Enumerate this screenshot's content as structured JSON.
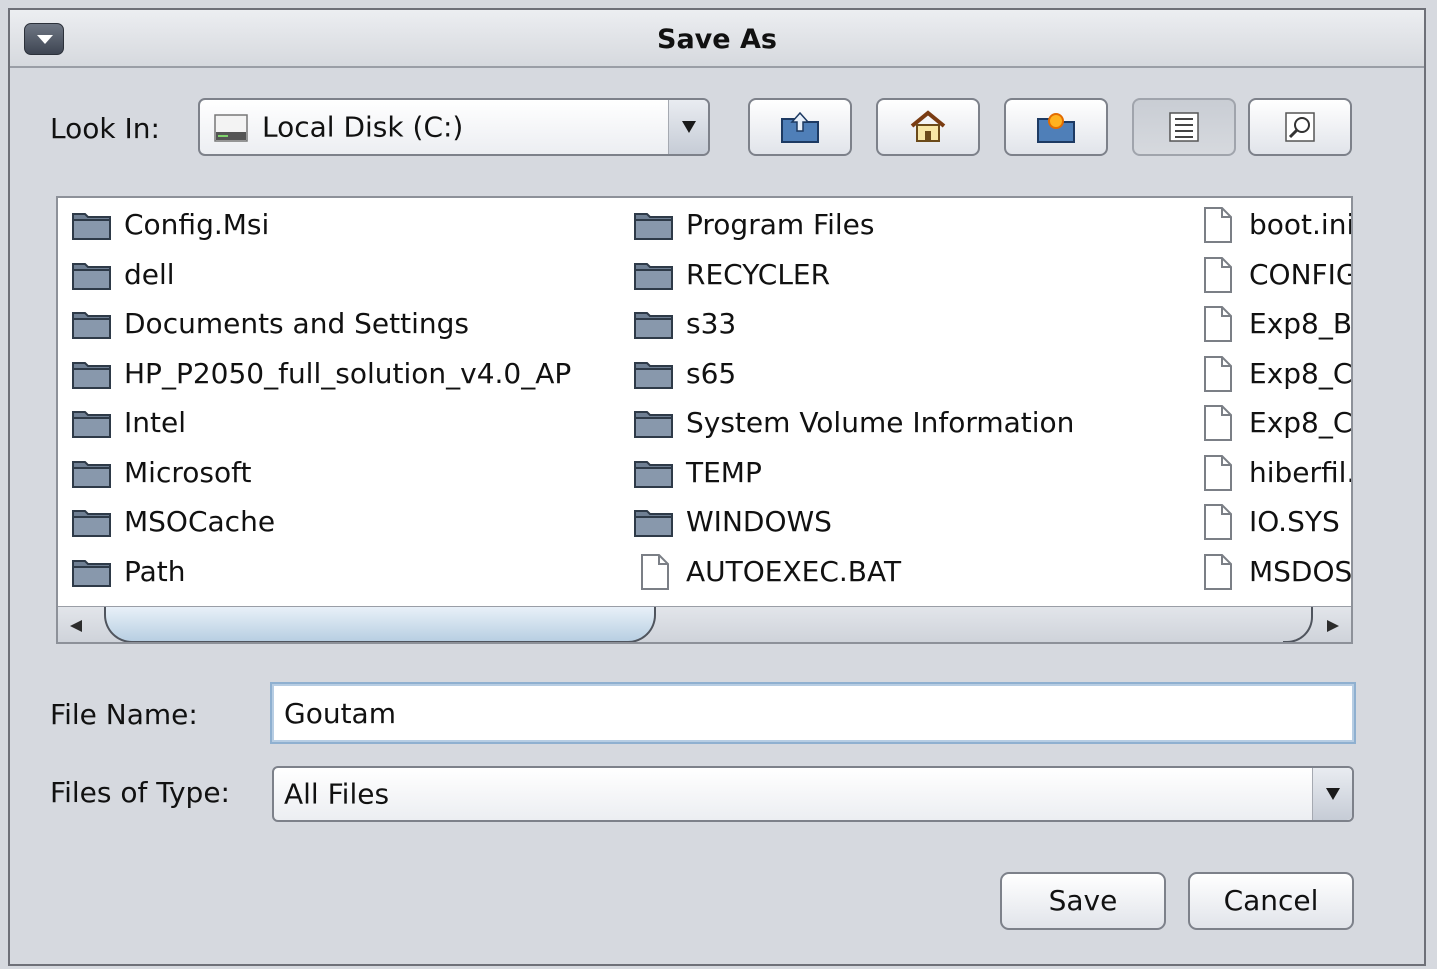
{
  "dialog": {
    "title": "Save As"
  },
  "look_in": {
    "label": "Look In:",
    "value": "Local Disk (C:)"
  },
  "toolbar": [
    {
      "name": "up-one-level-button",
      "icon": "folder-up-icon"
    },
    {
      "name": "home-button",
      "icon": "home-icon"
    },
    {
      "name": "new-folder-button",
      "icon": "new-folder-icon"
    },
    {
      "name": "list-view-button",
      "icon": "list-icon"
    },
    {
      "name": "details-view-button",
      "icon": "details-icon"
    }
  ],
  "files": {
    "column1": [
      {
        "name": "Config.Msi",
        "type": "folder"
      },
      {
        "name": "dell",
        "type": "folder"
      },
      {
        "name": "Documents and Settings",
        "type": "folder"
      },
      {
        "name": "HP_P2050_full_solution_v4.0_AP",
        "type": "folder"
      },
      {
        "name": "Intel",
        "type": "folder"
      },
      {
        "name": "Microsoft",
        "type": "folder"
      },
      {
        "name": "MSOCache",
        "type": "folder"
      },
      {
        "name": "Path",
        "type": "folder"
      }
    ],
    "column2": [
      {
        "name": "Program Files",
        "type": "folder"
      },
      {
        "name": "RECYCLER",
        "type": "folder"
      },
      {
        "name": "s33",
        "type": "folder"
      },
      {
        "name": "s65",
        "type": "folder"
      },
      {
        "name": "System Volume Information",
        "type": "folder"
      },
      {
        "name": "TEMP",
        "type": "folder"
      },
      {
        "name": "WINDOWS",
        "type": "folder"
      },
      {
        "name": "AUTOEXEC.BAT",
        "type": "file"
      }
    ],
    "column3": [
      {
        "name": "boot.ini",
        "type": "file"
      },
      {
        "name": "CONFIG",
        "type": "file"
      },
      {
        "name": "Exp8_B",
        "type": "file"
      },
      {
        "name": "Exp8_C",
        "type": "file"
      },
      {
        "name": "Exp8_C",
        "type": "file"
      },
      {
        "name": "hiberfil.",
        "type": "file"
      },
      {
        "name": "IO.SYS",
        "type": "file"
      },
      {
        "name": "MSDOS",
        "type": "file"
      }
    ]
  },
  "file_name": {
    "label": "File Name:",
    "value": "Goutam"
  },
  "file_type": {
    "label": "Files of Type:",
    "value": "All Files"
  },
  "buttons": {
    "save": "Save",
    "cancel": "Cancel"
  }
}
